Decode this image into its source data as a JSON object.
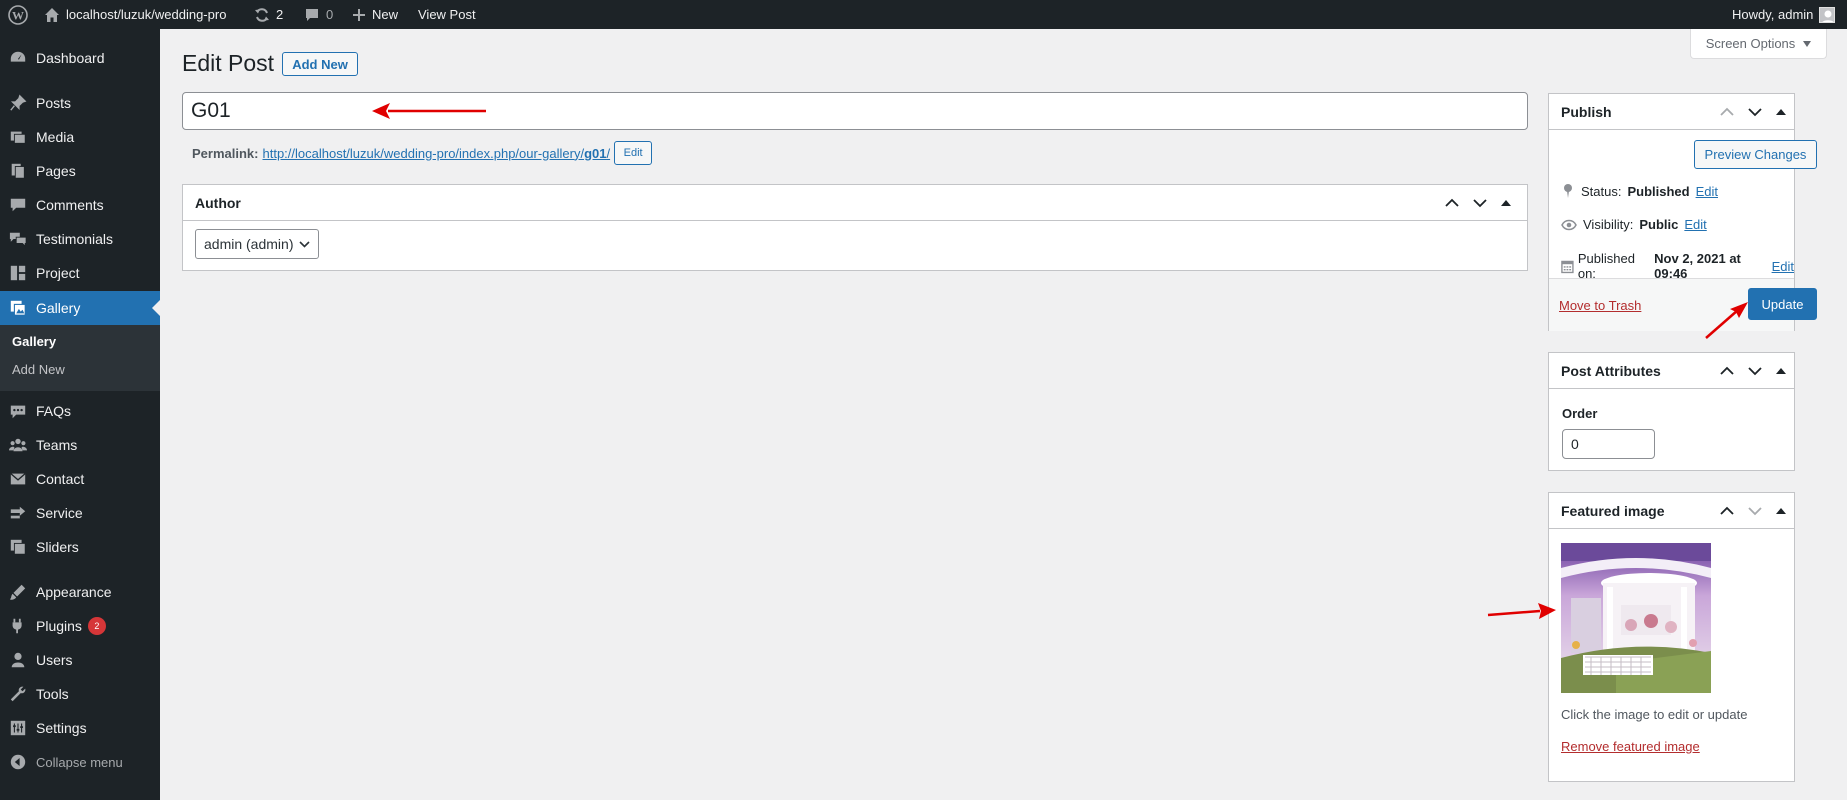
{
  "adminbar": {
    "site": "localhost/luzuk/wedding-pro",
    "updates_count": "2",
    "comments_count": "0",
    "new_label": "New",
    "view_post_label": "View Post",
    "howdy": "Howdy, admin"
  },
  "sidebar": {
    "items": [
      {
        "label": "Dashboard",
        "icon": "dashboard-icon"
      },
      {
        "label": "Posts",
        "icon": "pin-icon"
      },
      {
        "label": "Media",
        "icon": "media-icon"
      },
      {
        "label": "Pages",
        "icon": "pages-icon"
      },
      {
        "label": "Comments",
        "icon": "comment-icon"
      },
      {
        "label": "Testimonials",
        "icon": "testimonial-icon"
      },
      {
        "label": "Project",
        "icon": "project-icon"
      },
      {
        "label": "Gallery",
        "icon": "gallery-icon"
      },
      {
        "label": "FAQs",
        "icon": "faq-icon"
      },
      {
        "label": "Teams",
        "icon": "teams-icon"
      },
      {
        "label": "Contact",
        "icon": "contact-icon"
      },
      {
        "label": "Service",
        "icon": "service-icon"
      },
      {
        "label": "Sliders",
        "icon": "sliders-icon"
      },
      {
        "label": "Appearance",
        "icon": "appearance-icon"
      },
      {
        "label": "Plugins",
        "icon": "plugins-icon",
        "badge": "2"
      },
      {
        "label": "Users",
        "icon": "users-icon"
      },
      {
        "label": "Tools",
        "icon": "tools-icon"
      },
      {
        "label": "Settings",
        "icon": "settings-icon"
      },
      {
        "label": "Collapse menu",
        "icon": "collapse-icon"
      }
    ],
    "submenu": [
      "Gallery",
      "Add New"
    ]
  },
  "main": {
    "title": "Edit Post",
    "add_new": "Add New",
    "screen_options": "Screen Options",
    "post_title": "G01",
    "permalink_label": "Permalink:",
    "permalink_base": "http://localhost/luzuk/wedding-pro/index.php/our-gallery/",
    "permalink_slug": "g01",
    "permalink_trailing": "/",
    "permalink_edit": "Edit",
    "author": {
      "title": "Author",
      "selected": "admin (admin)"
    }
  },
  "publish": {
    "title": "Publish",
    "preview": "Preview Changes",
    "status_label": "Status:",
    "status_value": "Published",
    "visibility_label": "Visibility:",
    "visibility_value": "Public",
    "published_label": "Published on:",
    "published_value": "Nov 2, 2021 at 09:46",
    "edit": "Edit",
    "trash": "Move to Trash",
    "update": "Update"
  },
  "attributes": {
    "title": "Post Attributes",
    "order_label": "Order",
    "order_value": "0"
  },
  "featured": {
    "title": "Featured image",
    "hint": "Click the image to edit or update",
    "remove": "Remove featured image"
  },
  "colors": {
    "accent": "#2271b1",
    "admin_dark": "#1d2327",
    "danger": "#b32d2e",
    "annotation": "#e00000"
  }
}
